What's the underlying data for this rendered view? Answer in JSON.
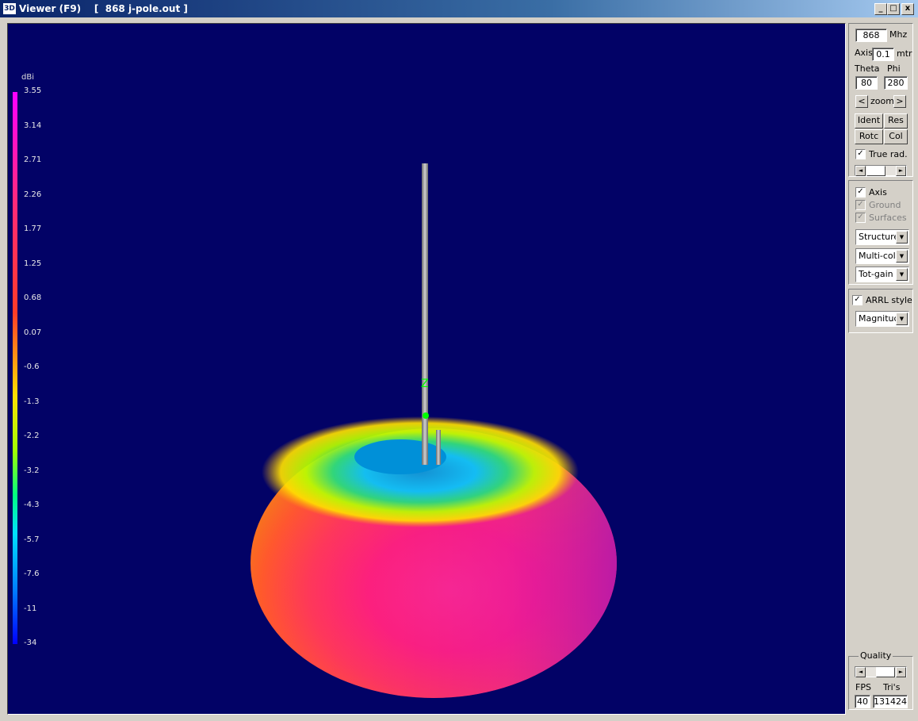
{
  "window": {
    "logo": "3D",
    "title": "Viewer (F9)    [  868 j-pole.out ]",
    "min_label": "_",
    "max_label": "□",
    "close_label": "x"
  },
  "scale": {
    "unit": "dBi",
    "ticks": [
      "3.55",
      "3.14",
      "2.71",
      "2.26",
      "1.77",
      "1.25",
      "0.68",
      "0.07",
      "-0.6",
      "-1.3",
      "-2.2",
      "-3.2",
      "-4.3",
      "-5.7",
      "-7.6",
      "-11",
      "-34"
    ]
  },
  "controls": {
    "freq_value": "868",
    "freq_unit": "Mhz",
    "axis_label": "Axis",
    "axis_value": "0.1",
    "axis_unit": "mtr",
    "theta_label": "Theta",
    "phi_label": "Phi",
    "theta_value": "80",
    "phi_value": "280",
    "zoom_label": "zoom",
    "zoom_left": "<",
    "zoom_right": ">",
    "ident_label": "Ident",
    "res_label": "Res",
    "rotc_label": "Rotc",
    "col_label": "Col",
    "true_rad_label": "True rad.",
    "true_rad_checked": "✓",
    "axis_check_label": "Axis",
    "axis_checked": "✓",
    "ground_label": "Ground",
    "ground_checked": "✓",
    "surfaces_label": "Surfaces",
    "surfaces_checked": "✓",
    "structure_value": "Structure",
    "color_value": "Multi-colo",
    "gain_value": "Tot-gain",
    "arrl_label": "ARRL style",
    "arrl_checked": "✓",
    "magnitude_value": "Magnituc",
    "quality_label": "Quality",
    "fps_label": "FPS",
    "tris_label": "Tri's",
    "fps_value": "40",
    "tris_value": "131424",
    "arrow_left": "◄",
    "arrow_right": "►",
    "dropdown_arrow": "▼"
  },
  "colors": {
    "background": "#020266",
    "pole": "#9a9a9a",
    "marker": "#00ff00"
  }
}
